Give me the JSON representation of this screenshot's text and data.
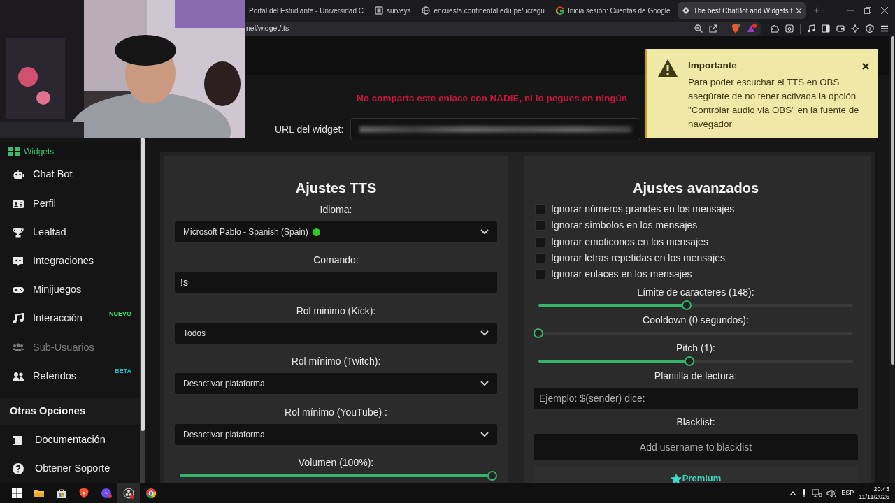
{
  "browser": {
    "tabs": [
      {
        "title": "Portal del Estudiante - Universidad C",
        "selected": false
      },
      {
        "title": "surveys",
        "selected": false
      },
      {
        "title": "encuesta.continental.edu.pe/ucregu",
        "selected": false
      },
      {
        "title": "Inicia sesión: Cuentas de Google",
        "selected": false
      },
      {
        "title": "The best ChatBot and Widgets f",
        "selected": true
      }
    ],
    "new_tab": "+",
    "address": "nel/widget/tts"
  },
  "sidebar": {
    "items": [
      {
        "label": "Widgets",
        "selected": true,
        "disabled": false
      },
      {
        "label": "Chat Bot",
        "selected": false,
        "disabled": false
      },
      {
        "label": "Perfil",
        "selected": false,
        "disabled": false
      },
      {
        "label": "Lealtad",
        "selected": false,
        "disabled": false
      },
      {
        "label": "Integraciones",
        "selected": false,
        "disabled": false
      },
      {
        "label": "Minijuegos",
        "selected": false,
        "disabled": false
      },
      {
        "label": "Interacción",
        "selected": false,
        "disabled": false,
        "badge": {
          "text": "NUEVO",
          "color": "#2fe06a"
        }
      },
      {
        "label": "Sub-Usuarios",
        "selected": false,
        "disabled": true
      },
      {
        "label": "Referidos",
        "selected": false,
        "disabled": false,
        "badge": {
          "text": "BETA",
          "color": "#22b8c0"
        }
      }
    ],
    "section_title": "Otras Opciones",
    "footer_items": [
      {
        "label": "Documentación"
      },
      {
        "label": "Obtener Soporte"
      }
    ]
  },
  "page": {
    "warning": "No comparta este enlace con NADIE, ni lo pegues en ningún",
    "url_label": "URL del widget:"
  },
  "toast": {
    "title": "Importante",
    "message": "Para poder escuchar el TTS en OBS asegúrate de no tener activada la opción \"Controlar audio via OBS\" en la fuente de navegador"
  },
  "tts": {
    "title": "Ajustes TTS",
    "fields": [
      {
        "kind": "select",
        "label": "Idioma:",
        "value": "Microsoft Pablo - Spanish (Spain)",
        "available": true
      },
      {
        "kind": "input",
        "label": "Comando:",
        "value": "!s"
      },
      {
        "kind": "select",
        "label": "Rol minimo (Kick):",
        "value": "Todos"
      },
      {
        "kind": "select",
        "label": "Rol mínimo (Twitch):",
        "value": "Desactivar plataforma"
      },
      {
        "kind": "select",
        "label": "Rol mínimo (YouTube) :",
        "value": "Desactivar plataforma"
      },
      {
        "kind": "slider",
        "label": "Volumen (100%):",
        "level": 1
      }
    ]
  },
  "advanced": {
    "title": "Ajustes avanzados",
    "options": [
      {
        "label": "Ignorar números grandes en los mensajes",
        "checked": false
      },
      {
        "label": "Ignorar símbolos en los mensajes",
        "checked": false
      },
      {
        "label": "Ignorar emoticonos en los mensajes",
        "checked": false
      },
      {
        "label": "Ignorar letras repetidas en los mensajes",
        "checked": false
      },
      {
        "label": "Ignorar enlaces en los mensajes",
        "checked": false
      }
    ],
    "fields": [
      {
        "kind": "slider",
        "label": "Límite de caracteres (148):",
        "level": 0.47
      },
      {
        "kind": "slider",
        "label": "Cooldown (0 segundos):",
        "level": 0
      },
      {
        "kind": "slider",
        "label": "Pitch (1):",
        "level": 0.48
      },
      {
        "kind": "input",
        "label": "Plantilla de lectura:",
        "placeholder": "Ejemplo: $(sender) dice:"
      },
      {
        "kind": "tags",
        "label": "Blacklist:",
        "placeholder": "Add username to blacklist"
      }
    ],
    "premium": "Premium"
  },
  "taskbar": {
    "language": "ESP",
    "time": "20:43",
    "date": "11/11/2025"
  }
}
